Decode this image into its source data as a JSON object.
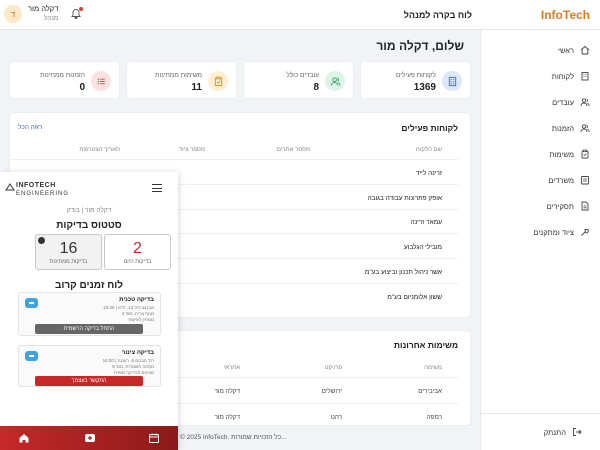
{
  "topbar": {
    "brand": "InfoTech",
    "title": "לוח בקרה למנהל",
    "user_name": "דקלה מור",
    "user_role": "מנהל",
    "avatar_letter": "ד"
  },
  "sidebar": {
    "items": [
      {
        "label": "ראשי",
        "icon": "home-icon"
      },
      {
        "label": "לקוחות",
        "icon": "building-icon"
      },
      {
        "label": "עובדים",
        "icon": "users-icon"
      },
      {
        "label": "הזמנות",
        "icon": "users-icon"
      },
      {
        "label": "משימות",
        "icon": "clipboard-icon"
      },
      {
        "label": "משרדים",
        "icon": "office-icon"
      },
      {
        "label": "תסקירים",
        "icon": "file-icon"
      },
      {
        "label": "ציוד ומתקנים",
        "icon": "tools-icon"
      }
    ],
    "logout": "התנתק"
  },
  "main": {
    "greeting": "שלום, דקלה מור",
    "stats": [
      {
        "label": "לקוחות פעילים",
        "value": "1369",
        "color": "#dbe7fb",
        "icon_color": "#3c6fd6"
      },
      {
        "label": "עובדים כולל",
        "value": "8",
        "color": "#dcf5e6",
        "icon_color": "#2fa35d"
      },
      {
        "label": "משימות ממתינות",
        "value": "11",
        "color": "#fdf0d2",
        "icon_color": "#d08a13"
      },
      {
        "label": "הזמנות ממתינות",
        "value": "0",
        "color": "#fde1e1",
        "icon_color": "#d84545"
      }
    ],
    "clients": {
      "title": "לקוחות פעילים",
      "see_all": "ראה הכל",
      "headers": [
        "שם הלקוח",
        "מספר אתרים",
        "מספר ציוד",
        "תאריך הצטרפות"
      ],
      "rows": [
        "זרינה לייד",
        "אופק פתרונות עבודה בגובה",
        "עמאר זרינה",
        "מובילי הגלבוע",
        "אשר ניהול תכנון וביצוע בע\"מ",
        "ששון אלומניום בע\"מ"
      ]
    },
    "tasks": {
      "title": "משימות אחרונות",
      "headers": [
        "משימה",
        "פרויקט",
        "אחראי"
      ],
      "rows": [
        {
          "task": "אביבירים",
          "project": "ירושלים",
          "owner": "דקלה מור"
        },
        {
          "task": "רמפה",
          "project": "רהט",
          "owner": "דקלה מור"
        }
      ]
    },
    "footer": "© 2025 InfoTech. כל הזכויות שמורות..."
  },
  "phone": {
    "logo_top": "INFOTECH",
    "logo_bottom": "ENGINEERING",
    "subtitle": "דקלה מור | בודק",
    "status_title": "סטטוס בדיקות",
    "status": [
      {
        "num": "2",
        "label": "בדיקות היום",
        "color": "#c62828"
      },
      {
        "num": "16",
        "label": "בדיקות ממתינות",
        "color": "#333333"
      }
    ],
    "schedule_title": "לוח זמנים קרוב",
    "cards": [
      {
        "title": "בדיקה טכנית",
        "line1": "15:30 | אבן גבירול 12, ת\"א",
        "line2": "מנוף צריח, מס' 4",
        "line3": "ממתין לאישור",
        "btn": "התחל בדיקה הרשמית",
        "btn_color": "#666666"
      },
      {
        "title": "בדיקה צינור",
        "line1": "16:00 | רח' הבנים 5, רעננה",
        "line2": "מלגזה חשמלית, מס' 8",
        "line3": "מוכנים לבדיקה סופית",
        "btn": "התקשר בעצמך",
        "btn_color": "#c62828"
      }
    ]
  }
}
